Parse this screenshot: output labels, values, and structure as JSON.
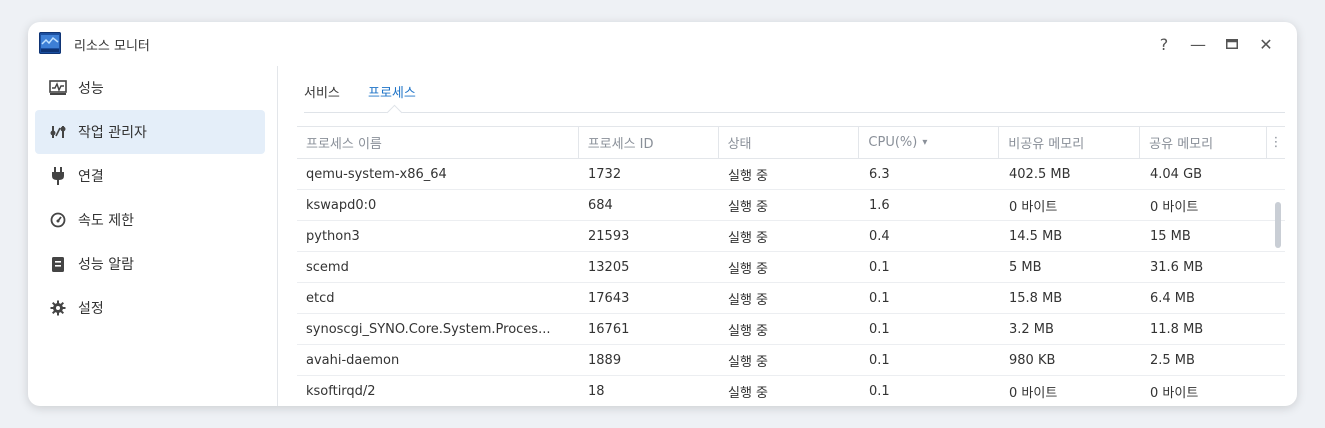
{
  "window": {
    "title": "리소스 모니터",
    "controls": {
      "help": "?",
      "minimize": "—",
      "maximize": "▭",
      "close": "✕"
    }
  },
  "sidebar": {
    "items": [
      {
        "label": "성능",
        "icon": "chart-monitor-icon"
      },
      {
        "label": "작업 관리자",
        "icon": "task-manager-icon",
        "active": true
      },
      {
        "label": "연결",
        "icon": "plug-icon"
      },
      {
        "label": "속도 제한",
        "icon": "speedometer-icon"
      },
      {
        "label": "성능 알람",
        "icon": "document-alarm-icon"
      },
      {
        "label": "설정",
        "icon": "gear-icon"
      }
    ]
  },
  "tabs": [
    {
      "label": "서비스",
      "active": false
    },
    {
      "label": "프로세스",
      "active": true
    }
  ],
  "table": {
    "headers": [
      "프로세스 이름",
      "프로세스 ID",
      "상태",
      "CPU(%)",
      "비공유 메모리",
      "공유 메모리"
    ],
    "sort_indicator": "▾",
    "menu_glyph": "⋮",
    "rows": [
      [
        "qemu-system-x86_64",
        "1732",
        "실행 중",
        "6.3",
        "402.5 MB",
        "4.04 GB"
      ],
      [
        "kswapd0:0",
        "684",
        "실행 중",
        "1.6",
        "0 바이트",
        "0 바이트"
      ],
      [
        "python3",
        "21593",
        "실행 중",
        "0.4",
        "14.5 MB",
        "15 MB"
      ],
      [
        "scemd",
        "13205",
        "실행 중",
        "0.1",
        "5 MB",
        "31.6 MB"
      ],
      [
        "etcd",
        "17643",
        "실행 중",
        "0.1",
        "15.8 MB",
        "6.4 MB"
      ],
      [
        "synoscgi_SYNO.Core.System.Proces...",
        "16761",
        "실행 중",
        "0.1",
        "3.2 MB",
        "11.8 MB"
      ],
      [
        "avahi-daemon",
        "1889",
        "실행 중",
        "0.1",
        "980 KB",
        "2.5 MB"
      ],
      [
        "ksoftirqd/2",
        "18",
        "실행 중",
        "0.1",
        "0 바이트",
        "0 바이트"
      ]
    ]
  },
  "colors": {
    "accent": "#1e73c7",
    "active_bg": "#e4eef9",
    "header_text": "#8a9099"
  }
}
